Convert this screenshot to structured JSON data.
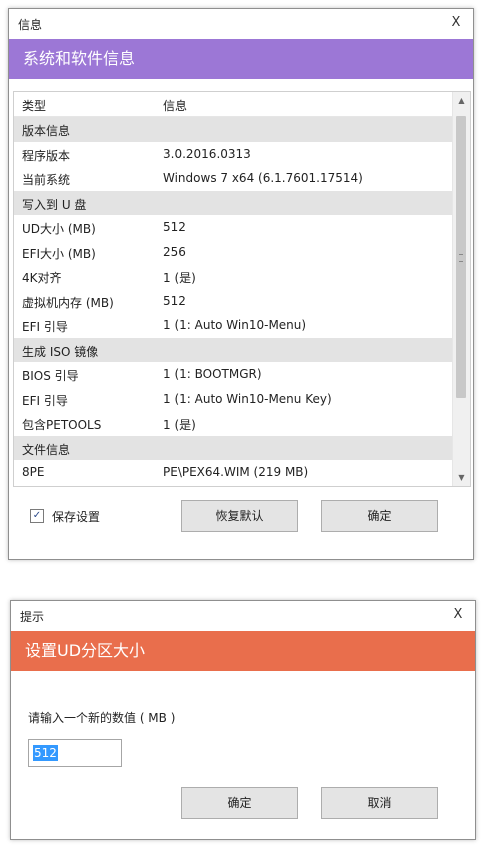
{
  "info_dialog": {
    "title": "信息",
    "close_glyph": "X",
    "banner": "系统和软件信息",
    "banner_color": "#9c77d6",
    "columns": [
      "类型",
      "信息"
    ],
    "rows": [
      {
        "type": "section",
        "label": "版本信息"
      },
      {
        "type": "item",
        "label": "程序版本",
        "value": "3.0.2016.0313"
      },
      {
        "type": "item",
        "label": "当前系统",
        "value": "Windows 7 x64 (6.1.7601.17514)"
      },
      {
        "type": "section",
        "label": "写入到 U 盘"
      },
      {
        "type": "item",
        "label": "UD大小 (MB)",
        "value": "512"
      },
      {
        "type": "item",
        "label": "EFI大小 (MB)",
        "value": "256"
      },
      {
        "type": "item",
        "label": "4K对齐",
        "value": "1 (是)"
      },
      {
        "type": "item",
        "label": "虚拟机内存 (MB)",
        "value": "512"
      },
      {
        "type": "item",
        "label": "EFI 引导",
        "value": "1 (1: Auto Win10-Menu)"
      },
      {
        "type": "section",
        "label": "生成 ISO 镜像"
      },
      {
        "type": "item",
        "label": "BIOS 引导",
        "value": "1 (1: BOOTMGR)"
      },
      {
        "type": "item",
        "label": "EFI 引导",
        "value": "1 (1: Auto Win10-Menu Key)"
      },
      {
        "type": "item",
        "label": "包含PETOOLS",
        "value": "1 (是)"
      },
      {
        "type": "section",
        "label": "文件信息"
      },
      {
        "type": "item",
        "label": "8PE",
        "value": "PE\\PEX64.WIM (219 MB)"
      }
    ],
    "save_settings": {
      "label": "保存设置",
      "checked": true
    },
    "restore_default_label": "恢复默认",
    "ok_label": "确定"
  },
  "prompt_dialog": {
    "title": "提示",
    "close_glyph": "X",
    "banner": "设置UD分区大小",
    "banner_color": "#e96e4c",
    "prompt_text": "请输入一个新的数值 ( MB )",
    "input_value": "512",
    "ok_label": "确定",
    "cancel_label": "取消"
  }
}
